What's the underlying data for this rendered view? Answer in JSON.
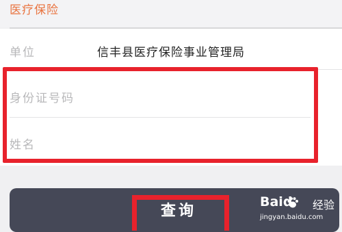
{
  "section": {
    "title": "医疗保险"
  },
  "unit": {
    "label": "单位",
    "value": "信丰县医疗保险事业管理局"
  },
  "form": {
    "id_number": {
      "placeholder": "身份证号码",
      "value": ""
    },
    "name": {
      "placeholder": "姓名",
      "value": ""
    }
  },
  "actions": {
    "query_label": "查询"
  },
  "watermark": {
    "brand": "Baid",
    "text": "经验",
    "url": "jingyan.baidu.com"
  },
  "colors": {
    "accent": "#e9733f",
    "highlight": "#e8222c",
    "button_bg": "#454857",
    "page_bg": "#f0f0f2"
  },
  "icons": {
    "watermark_logo": "baidu-paw-icon"
  }
}
